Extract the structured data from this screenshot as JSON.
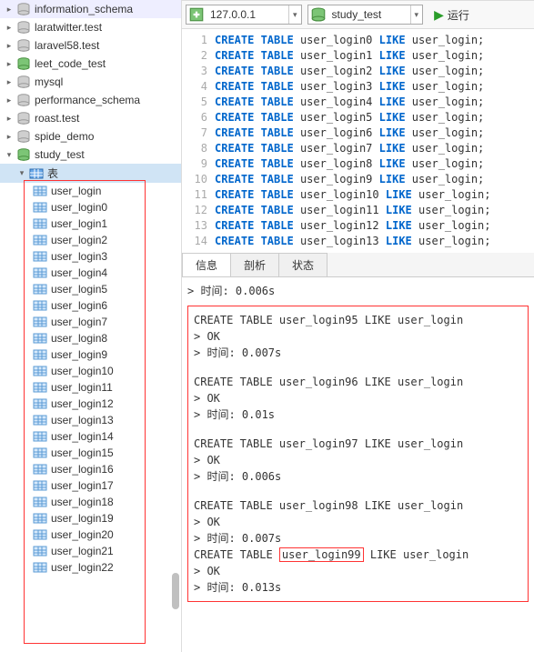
{
  "sidebar": {
    "databases": [
      {
        "name": "information_schema",
        "icon": "db"
      },
      {
        "name": "laratwitter.test",
        "icon": "db"
      },
      {
        "name": "laravel58.test",
        "icon": "db"
      },
      {
        "name": "leet_code_test",
        "icon": "db-green"
      },
      {
        "name": "mysql",
        "icon": "db"
      },
      {
        "name": "performance_schema",
        "icon": "db"
      },
      {
        "name": "roast.test",
        "icon": "db"
      },
      {
        "name": "spide_demo",
        "icon": "db"
      },
      {
        "name": "study_test",
        "icon": "db-green"
      }
    ],
    "folder_label": "表",
    "tables": [
      "user_login",
      "user_login0",
      "user_login1",
      "user_login2",
      "user_login3",
      "user_login4",
      "user_login5",
      "user_login6",
      "user_login7",
      "user_login8",
      "user_login9",
      "user_login10",
      "user_login11",
      "user_login12",
      "user_login13",
      "user_login14",
      "user_login15",
      "user_login16",
      "user_login17",
      "user_login18",
      "user_login19",
      "user_login20",
      "user_login21",
      "user_login22"
    ]
  },
  "toolbar": {
    "host": "127.0.0.1",
    "db": "study_test",
    "run_label": "运行"
  },
  "editor": {
    "lines": [
      {
        "n": 1,
        "kw": "CREATE TABLE",
        "mid": "user_login0",
        "kw2": "LIKE",
        "tail": "user_login;"
      },
      {
        "n": 2,
        "kw": "CREATE TABLE",
        "mid": "user_login1",
        "kw2": "LIKE",
        "tail": "user_login;"
      },
      {
        "n": 3,
        "kw": "CREATE TABLE",
        "mid": "user_login2",
        "kw2": "LIKE",
        "tail": "user_login;"
      },
      {
        "n": 4,
        "kw": "CREATE TABLE",
        "mid": "user_login3",
        "kw2": "LIKE",
        "tail": "user_login;"
      },
      {
        "n": 5,
        "kw": "CREATE TABLE",
        "mid": "user_login4",
        "kw2": "LIKE",
        "tail": "user_login;"
      },
      {
        "n": 6,
        "kw": "CREATE TABLE",
        "mid": "user_login5",
        "kw2": "LIKE",
        "tail": "user_login;"
      },
      {
        "n": 7,
        "kw": "CREATE TABLE",
        "mid": "user_login6",
        "kw2": "LIKE",
        "tail": "user_login;"
      },
      {
        "n": 8,
        "kw": "CREATE TABLE",
        "mid": "user_login7",
        "kw2": "LIKE",
        "tail": "user_login;"
      },
      {
        "n": 9,
        "kw": "CREATE TABLE",
        "mid": "user_login8",
        "kw2": "LIKE",
        "tail": "user_login;"
      },
      {
        "n": 10,
        "kw": "CREATE TABLE",
        "mid": "user_login9",
        "kw2": "LIKE",
        "tail": "user_login;"
      },
      {
        "n": 11,
        "kw": "CREATE TABLE",
        "mid": "user_login10",
        "kw2": "LIKE",
        "tail": "user_login;"
      },
      {
        "n": 12,
        "kw": "CREATE TABLE",
        "mid": "user_login11",
        "kw2": "LIKE",
        "tail": "user_login;"
      },
      {
        "n": 13,
        "kw": "CREATE TABLE",
        "mid": "user_login12",
        "kw2": "LIKE",
        "tail": "user_login;"
      },
      {
        "n": 14,
        "kw": "CREATE TABLE",
        "mid": "user_login13",
        "kw2": "LIKE",
        "tail": "user_login;"
      }
    ]
  },
  "tabs": {
    "t1": "信息",
    "t2": "剖析",
    "t3": "状态"
  },
  "output": {
    "summary_prefix": "> 时间: ",
    "summary_time": "0.006s",
    "ok": "> OK",
    "time_label": "> 时间: ",
    "blocks": [
      {
        "sql": "CREATE TABLE user_login95 LIKE user_login",
        "time": "0.007s"
      },
      {
        "sql": "CREATE TABLE user_login96 LIKE user_login",
        "time": "0.01s"
      },
      {
        "sql": "CREATE TABLE user_login97 LIKE user_login",
        "time": "0.006s"
      },
      {
        "sql": "CREATE TABLE user_login98 LIKE user_login",
        "time": "0.007s"
      }
    ],
    "last": {
      "pre": "CREATE TABLE ",
      "hl": "user_login99",
      "post": " LIKE user_login",
      "time": "0.013s"
    }
  }
}
